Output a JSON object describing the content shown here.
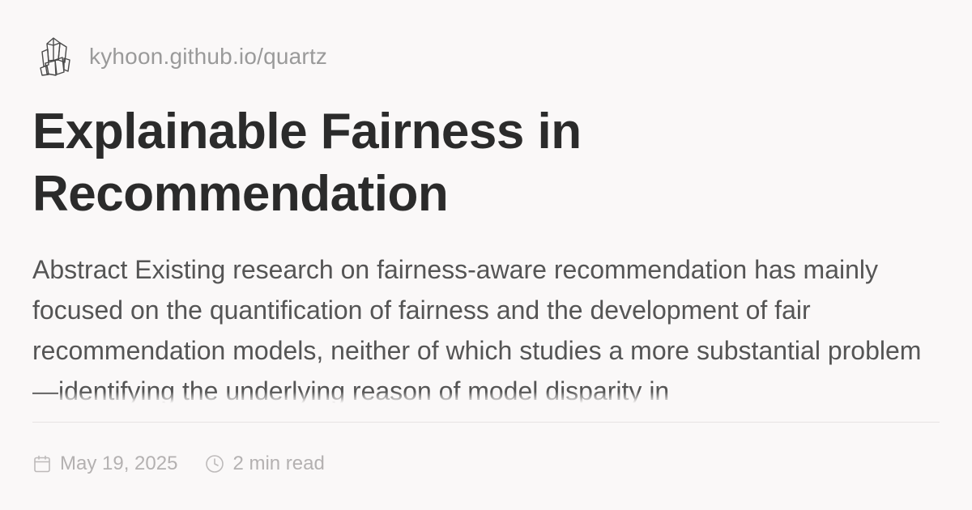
{
  "site": {
    "url": "kyhoon.github.io/quartz",
    "logo_icon": "crystal-icon"
  },
  "article": {
    "title": "Explainable Fairness in Recommendation",
    "abstract": "Abstract Existing research on fairness-aware recommendation has mainly focused on the quantification of fairness and the development of fair recommendation models, neither of which studies a more substantial problem—identifying the underlying reason of model disparity in"
  },
  "meta": {
    "date": "May 19, 2025",
    "date_icon": "calendar-icon",
    "read_time": "2 min read",
    "read_time_icon": "clock-icon"
  },
  "colors": {
    "background": "#faf8f8",
    "title": "#2b2b2b",
    "abstract": "#555555",
    "muted": "#9a9a9a"
  }
}
